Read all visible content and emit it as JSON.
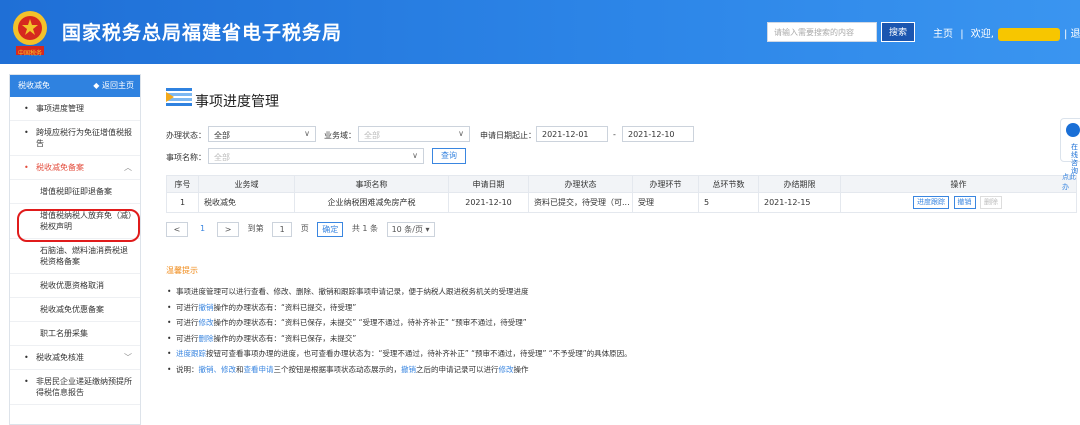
{
  "header": {
    "title": "国家税务总局福建省电子税务局",
    "search_placeholder": "请输入需要搜索的内容",
    "search_label": "搜索",
    "home_label": "主页",
    "divider": "|",
    "welcome_label": "欢迎,",
    "exit_label": "| 退出",
    "brand_color": "#2d86e8",
    "emblem_text": "中国税务"
  },
  "sidebar": {
    "title": "税收减免",
    "back_label": "返回主页",
    "items": [
      {
        "label": "事项进度管理"
      },
      {
        "label": "跨境应税行为免征增值税报告"
      },
      {
        "label": "税收减免备案"
      },
      {
        "label": "增值税即征即退备案"
      },
      {
        "label": "增值税纳税人放弃免（减）税权声明"
      },
      {
        "label": "石脑油、燃料油消费税退税资格备案"
      },
      {
        "label": "税收优惠资格取消"
      },
      {
        "label": "税收减免优惠备案"
      },
      {
        "label": "职工名册采集"
      },
      {
        "label": "税收减免核准"
      },
      {
        "label": "非居民企业递延缴纳预提所得税信息报告"
      }
    ]
  },
  "main": {
    "title": "事项进度管理",
    "filters": {
      "status_label": "办理状态：",
      "status_value": "全部",
      "domain_label": "业务域：",
      "domain_value": "全部",
      "date_label": "申请日期起止：",
      "date_from": "2021-12-01",
      "date_sep": "-",
      "date_to": "2021-12-10",
      "name_label": "事项名称：",
      "name_value": "全部",
      "query_label": "查询"
    },
    "table": {
      "headers": [
        "序号",
        "业务域",
        "事项名称",
        "申请日期",
        "办理状态",
        "办理环节",
        "总环节数",
        "办结期限",
        "操作"
      ],
      "rows": [
        {
          "index": "1",
          "domain": "税收减免",
          "name": "企业纳税困难减免房产税",
          "date": "2021-12-10",
          "status": "资料已提交，待受理（可...",
          "step": "受理",
          "total": "5",
          "deadline": "2021-12-15",
          "ops": [
            "进度跟踪",
            "撤销",
            "删除"
          ]
        }
      ]
    },
    "pager": {
      "prev": "<",
      "current": "1",
      "next": ">",
      "goto_label": "到第",
      "goto_value": "1",
      "page_unit": "页",
      "confirm_label": "确定",
      "total_label": "共 1 条",
      "page_size": "10 条/页"
    },
    "tips": {
      "title": "温馨提示",
      "lines": [
        {
          "parts": [
            "事项进度管理可以进行查看、修改、删除、撤销和跟踪事项申请记录，便于纳税人跟进税务机关的受理进度"
          ]
        },
        {
          "parts": [
            "可进行",
            "撤销",
            "操作的办理状态有：“资料已提交，待受理”"
          ]
        },
        {
          "parts": [
            "可进行",
            "修改",
            "操作的办理状态有：“资料已保存，未提交”  “受理不通过，待补齐补正”  “预审不通过，待受理”"
          ]
        },
        {
          "parts": [
            "可进行",
            "删除",
            "操作的办理状态有：“资料已保存，未提交”"
          ]
        },
        {
          "parts": [
            "",
            "进度跟踪",
            "按钮可查看事项办理的进度，也可查看办理状态为：“受理不通过，待补齐补正”  “预审不通过，待受理”  “不予受理”的具体原因。"
          ]
        },
        {
          "parts": [
            "说明：",
            "撤销、修改",
            "和",
            "查看申请",
            "三个按钮是根据事项状态动态展示的，",
            "撤销",
            "之后的申请记录可以进行",
            "修改",
            "操作"
          ]
        }
      ]
    }
  },
  "right_edge": {
    "help_text": "在线咨询",
    "link_text": "点此办"
  }
}
